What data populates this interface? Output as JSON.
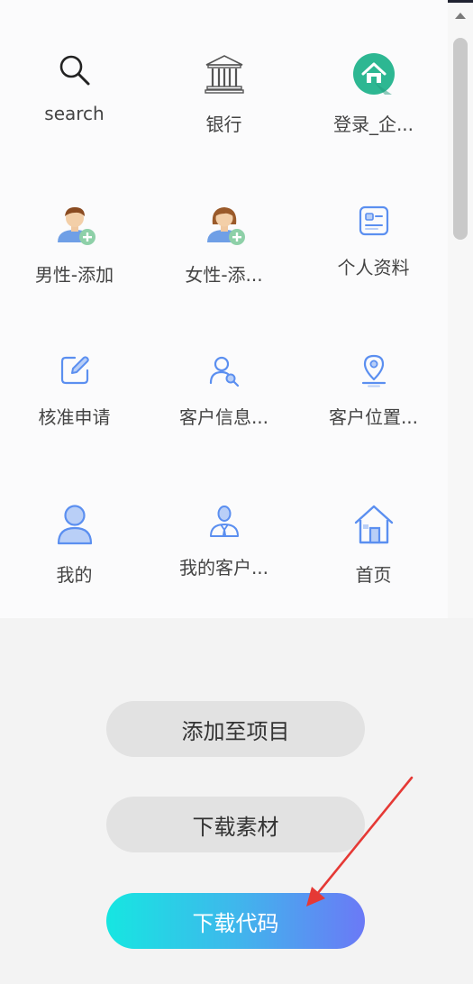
{
  "icons": [
    {
      "label": "search",
      "icon": "search-icon"
    },
    {
      "label": "银行",
      "icon": "bank-icon"
    },
    {
      "label": "登录_企...",
      "icon": "home-login-icon"
    },
    {
      "label": "男性-添加",
      "icon": "male-add-icon"
    },
    {
      "label": "女性-添...",
      "icon": "female-add-icon"
    },
    {
      "label": "个人资料",
      "icon": "profile-card-icon"
    },
    {
      "label": "核准申请",
      "icon": "edit-square-icon"
    },
    {
      "label": "客户信息...",
      "icon": "customer-search-icon"
    },
    {
      "label": "客户位置...",
      "icon": "location-pin-icon"
    },
    {
      "label": "我的",
      "icon": "user-icon"
    },
    {
      "label": "我的客户...",
      "icon": "my-customer-icon"
    },
    {
      "label": "首页",
      "icon": "house-icon"
    }
  ],
  "actions": {
    "add_to_project": "添加至项目",
    "download_assets": "下载素材",
    "download_code": "下载代码"
  },
  "colors": {
    "icon_blue": "#5b8ff0",
    "icon_blue_fill": "#b9cff7",
    "login_green": "#2db792",
    "gradient_start": "#16e6e1",
    "gradient_end": "#6b79f6",
    "arrow_red": "#e53935"
  }
}
